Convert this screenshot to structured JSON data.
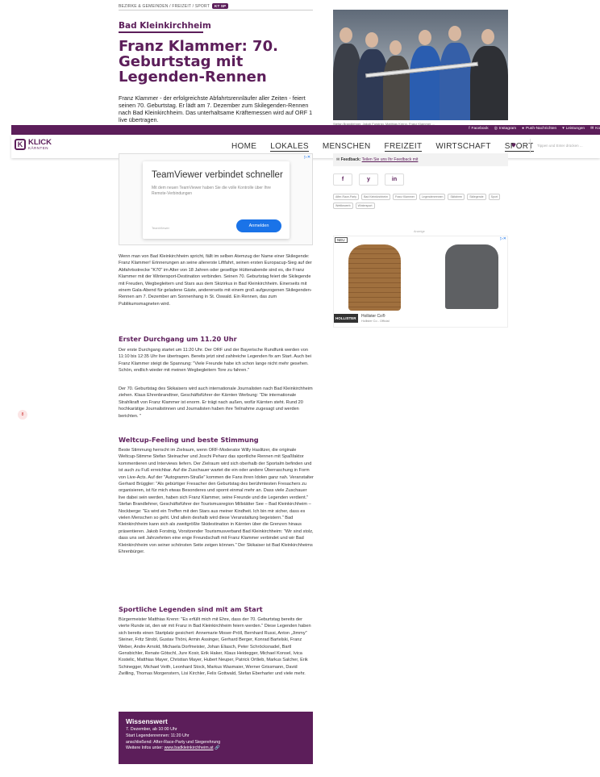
{
  "breadcrumb": {
    "text": "BEZIRKE & GEMEINDEN / FREIZEIT / SPORT",
    "badge": "KT SP"
  },
  "region": "Bad Kleinkirchheim",
  "article": {
    "title": "Franz Klammer: 70. Geburtstag mit Legenden-Rennen",
    "lead": "Franz Klammer - der erfolgreichste Abfahrtsrennläufer aller Zeiten - feiert seinen 70. Geburtstag. Er lädt am 7. Dezember zum Skilegenden-Rennen nach Bad Kleinkirchheim. Das unterhaltsame Kräftemessen wird auf ORF 1 live übertragen.",
    "photo_caption": "Stefan Brandlehner, Jakob Forstnig, Matthias Krenn, Franz Klammer ...",
    "intro": "Wenn man von Bad Kleinkirchheim spricht, fällt im selben Atemzug der Name einer Skilegende: Franz Klammer! Erinnerungen an seine allererste Liftfahrt, seinen ersten Europacup-Sieg auf der Abfahrtsstrecke \"K70\" im Alter von 18 Jahren oder gesellige Hüttenabende sind es, die Franz Klammer mit der Wintersport-Destination verbinden. Seinen 70. Geburtstag feiert die Skilegende mit Freuden, Wegbegleitern und Stars aus dem Skizirkus in Bad Kleinkirchheim. Einerseits mit einem Gala-Abend für geladene Gäste, andererseits mit einem groß aufgezogenen Skilegenden-Rennen am 7. Dezember am Sonnenhang in St. Oswald. Ein Rennen, das zum Publikumsmagneten wird.",
    "h1": "Erster Durchgang um 11.20 Uhr",
    "p1": "Der erste Durchgang startet um 11:20 Uhr. Der ORF und der Bayerische Rundfunk werden von 11:10 bis 12:35 Uhr live übertragen. Bereits jetzt sind zahlreiche Legenden fix am Start. Auch bei Franz Klammer steigt die Spannung: \"Viele Freunde habe ich schon lange nicht mehr gesehen. Schön, endlich wieder mit meinen Wegbegleitern Tore zu fahren.\"",
    "p2": "Der 70. Geburtstag des Skikaisers wird auch internationale Journalisten nach Bad Kleinkirchheim ziehen. Klaus Ehrenbrandtner, Geschäftsführer der Kärnten Werbung: \"Die internationale Strahlkraft von Franz Klammer ist enorm. Er trägt nach außen, wofür Kärnten steht. Rund 20 hochkarätige Journalistinnen und Journalisten haben ihre Teilnahme zugesagt und werden berichten. \"",
    "h2": "Weltcup-Feeling und beste Stimmung",
    "p3": "Beste Stimmung herrscht im Zielraum, wenn ORF-Moderator Willy Haslitzer, die originale Weltcup-Stimme Stefan Steinacher und Joschi Peharz das sportliche Rennen mit Spaßfaktor kommentieren und Interviews liefern. Der Zielraum wird sich oberhalb der Sportalm befinden und ist auch zu Fuß erreichbar. Auf die Zuschauer wartet die ein oder andere Überraschung in Form von Live-Acts. Auf der \"Autogramm-Straße\" kommen die Fans ihren Idolen ganz nah. Veranstalter Gerhard Brüggler: \"Als gebürtiger Fresacher den Geburtstag des berühmtesten Fresachers zu organisieren, ist für mich etwas Besonderes und spornt einmal mehr an. Dass viele Zuschauer live dabei sein werden, haben sich Franz Klammer, seine Freunde und die Legenden verdient.\" Stefan Brandlehner, Geschäftsführer der Tourismusregion Millstätter See – Bad Kleinkirchheim – Nockberge: \"Es wird ein Treffen mit den Stars aus meiner Kindheit. Ich bin mir sicher, dass es vielen Menschen so geht. Und allein deshalb wird diese Veranstaltung begeistern.\" Bad Kleinkirchheim kann sich als zweitgrößte Skidestination in Kärnten über die Grenzen hinaus präsentieren. Jakob Forstnig, Vorsitzender Tourismusverband Bad Kleinkirchheim: \"Wir sind stolz, dass uns seit Jahrzehnten eine enge Freundschaft mit Franz Klammer verbindet und wir Bad Kleinkirchheim von seiner schönsten Seite zeigen können.\" Der Skikaiser ist Bad Kleinkirchheims Ehrenbürger.",
    "h3": "Sportliche Legenden sind mit am Start",
    "p4": "Bürgermeister Matthias Krenn: \"Es erfüllt mich mit Ehre, dass der 70. Geburtstag bereits der vierte Runde ist, den wir mit Franz in Bad Kleinkirchheim feiern werden.\" Diese Legenden haben sich bereits einen Startplatz gesichert: Annemarie Moser-Pröll, Bernhard Russi, Anton „Jimmy\" Steiner, Fritz Strobl, Gustav Thöni, Armin Assinger, Gerhard Berger, Konrad Bartelski, Franz Weber, Andre Arnold, Michaela Dorfmeister, Johan Eliasch, Peter Schröcksnadel, Bartl Gensbichler, Renate Götschl, Jure Kosir, Erik Haker, Klaus Heidegger, Michael Konsel, Ivica Kostelic, Matthias Mayer, Christian Mayer, Hubert Neuper, Patrick Ortlieb, Markus Salcher, Erik Schinegger, Michael Veith, Leonhard Stock, Markus Wasmaier, Werner Grissmann, David Zwilling, Thomas Morgenstern, Lisi Kirchler, Felix Gottwald, Stefan Eberharter und viele mehr."
  },
  "info_box": {
    "title": "Wissenswert",
    "line1": "7. Dezember, ab 10:00 Uhr",
    "line2": "Start Legendenrennen: 11:20 Uhr",
    "line3": "anschließend: After-Race-Party und Siegerehrung",
    "link_prefix": "Weitere Infos unter: ",
    "link": "www.badkleinkirchheim.at"
  },
  "top_strip": {
    "facebook": "Facebook",
    "instagram": "Instagram",
    "push": "Push-Nachrichten",
    "services": "Leistungen",
    "more": "Ko"
  },
  "logo": {
    "line1": "KLICK",
    "line2": "KÄRNTEN"
  },
  "nav": [
    "HOME",
    "LOKALES",
    "MENSCHEN",
    "FREIZEIT",
    "WIRTSCHAFT",
    "SPORT"
  ],
  "search_placeholder": "Tippen und Enter drücken ...",
  "ad": {
    "title": "TeamViewer verbindet schneller",
    "text": "Mit dem neuen TeamViewer haben Sie die volle Kontrolle über Ihre Remote-Verbindungen",
    "brand": "TeamViewer",
    "button": "Anmelden"
  },
  "feedback": {
    "label": "Feedback:",
    "link": "Teilen Sie uns Ihr Feedback mit"
  },
  "share": [
    "f",
    "y",
    "in"
  ],
  "tags": [
    "After-Race-Party",
    "Bad Kleinkirchheim",
    "Franz Klammer",
    "Legendenrennen",
    "Skifahren",
    "Skilegende",
    "Sport",
    "Wettbewerb",
    "Wintersport"
  ],
  "ad2": {
    "label": "Anzeige",
    "new": "NEU",
    "logo": "HOLLISTER",
    "name": "Hollister Co®",
    "sub": "Hollister Co - Official"
  },
  "side_badge": "8"
}
